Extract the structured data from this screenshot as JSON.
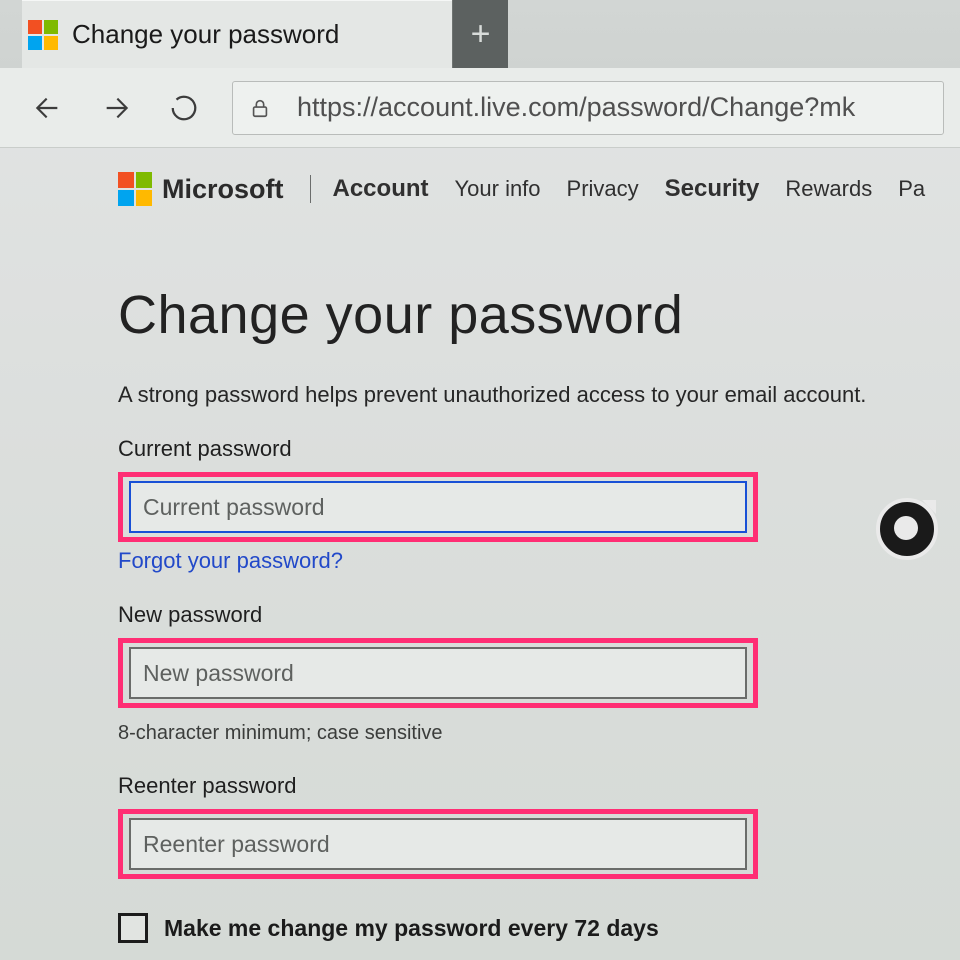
{
  "browser": {
    "tab_title": "Change your password",
    "url": "https://account.live.com/password/Change?mk"
  },
  "siteheader": {
    "brand": "Microsoft",
    "links": [
      "Account",
      "Your info",
      "Privacy",
      "Security",
      "Rewards",
      "Pa"
    ]
  },
  "page": {
    "title": "Change your password",
    "subtitle": "A strong password helps prevent unauthorized access to your email account.",
    "current_label": "Current password",
    "current_placeholder": "Current password",
    "forgot": "Forgot your password?",
    "new_label": "New password",
    "new_placeholder": "New password",
    "hint": "8-character minimum; case sensitive",
    "reenter_label": "Reenter password",
    "reenter_placeholder": "Reenter password",
    "checkbox_label": "Make me change my password every 72 days"
  }
}
